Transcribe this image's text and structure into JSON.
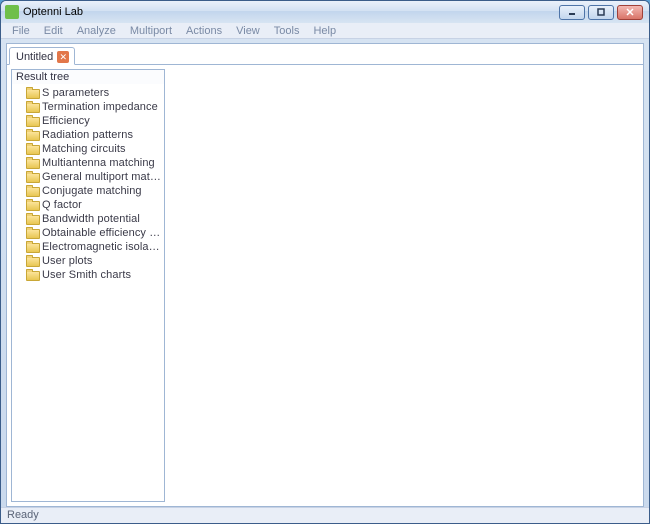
{
  "window": {
    "title": "Optenni Lab"
  },
  "menubar": {
    "items": [
      "File",
      "Edit",
      "Analyze",
      "Multiport",
      "Actions",
      "View",
      "Tools",
      "Help"
    ]
  },
  "tabs": {
    "active_label": "Untitled"
  },
  "tree": {
    "header": "Result tree",
    "items": [
      "S parameters",
      "Termination impedance",
      "Efficiency",
      "Radiation patterns",
      "Matching circuits",
      "Multiantenna matching",
      "General multiport matching",
      "Conjugate matching",
      "Q factor",
      "Bandwidth potential",
      "Obtainable efficiency bandwi***",
      "Electromagnetic isolation",
      "User plots",
      "User Smith charts"
    ]
  },
  "statusbar": {
    "text": "Ready"
  }
}
